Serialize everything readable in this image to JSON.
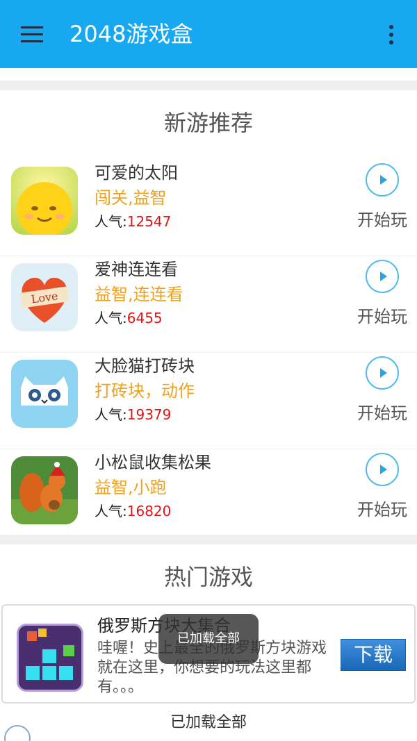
{
  "appbar": {
    "title": "2048游戏盒",
    "menu_icon": "hamburger-menu-icon",
    "more_icon": "overflow-menu-icon"
  },
  "new_games": {
    "section_title": "新游推荐",
    "items": [
      {
        "name": "可爱的太阳",
        "tags": "闯关,益智",
        "pop_label": "人气:",
        "pop_value": "12547",
        "play_label": "开始玩",
        "icon": "cute-sun-icon"
      },
      {
        "name": "爱神连连看",
        "tags": "益智,连连看",
        "pop_label": "人气:",
        "pop_value": "6455",
        "play_label": "开始玩",
        "icon": "love-heart-icon"
      },
      {
        "name": "大脸猫打砖块",
        "tags": "打砖块，动作",
        "pop_label": "人气:",
        "pop_value": "19379",
        "play_label": "开始玩",
        "icon": "cat-face-icon"
      },
      {
        "name": "小松鼠收集松果",
        "tags": "益智,小跑",
        "pop_label": "人气:",
        "pop_value": "16820",
        "play_label": "开始玩",
        "icon": "squirrel-icon"
      }
    ]
  },
  "hot_games": {
    "section_title": "热门游戏",
    "item": {
      "name": "俄罗斯方块大集合",
      "desc": "哇喔！史上最全的俄罗斯方块游戏就在这里，你想要的玩法这里都有。。。",
      "download_label": "下载",
      "icon": "tetris-blocks-icon"
    }
  },
  "footer": {
    "loaded_text": "已加载全部"
  },
  "toast": {
    "text": "已加载全部"
  },
  "colors": {
    "appbar": "#18a8f0",
    "tag": "#f0a21c",
    "popularity": "#e01515",
    "download": "#1a68b8"
  }
}
